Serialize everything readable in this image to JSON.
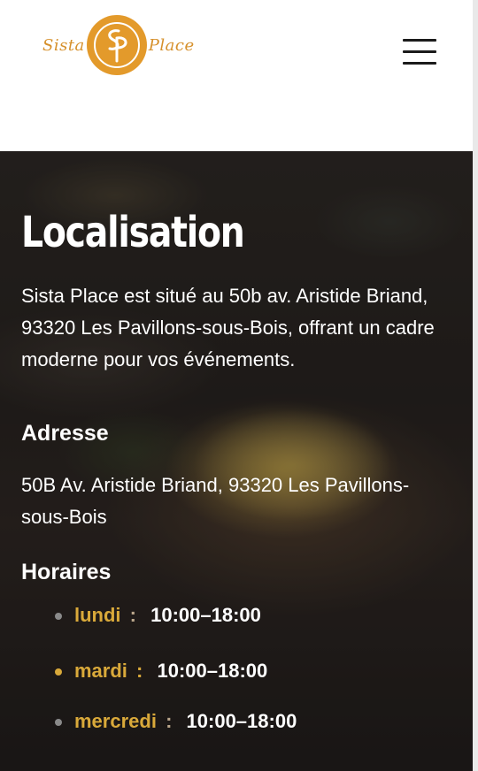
{
  "header": {
    "logo": {
      "left_word": "Sista",
      "right_word": "Place",
      "monogram": "SP"
    },
    "menu_icon": "hamburger-menu-icon"
  },
  "hero": {
    "title": "Localisation",
    "intro": "Sista Place est situé au 50b av. Aristide Briand, 93320 Les Pavillons-sous-Bois, offrant un cadre moderne pour vos événements.",
    "address_heading": "Adresse",
    "address": "50B Av. Aristide Briand, 93320 Les Pavillons-sous-Bois",
    "hours_heading": "Horaires",
    "hours": [
      {
        "day": "lundi",
        "colon": ":",
        "time": "10:00–18:00"
      },
      {
        "day": "mardi",
        "colon": ":",
        "time": "10:00–18:00"
      },
      {
        "day": "mercredi",
        "colon": ":",
        "time": "10:00–18:00"
      }
    ]
  },
  "colors": {
    "accent": "#d9a93a",
    "logo": "#e39a2b",
    "text": "#ffffff"
  }
}
